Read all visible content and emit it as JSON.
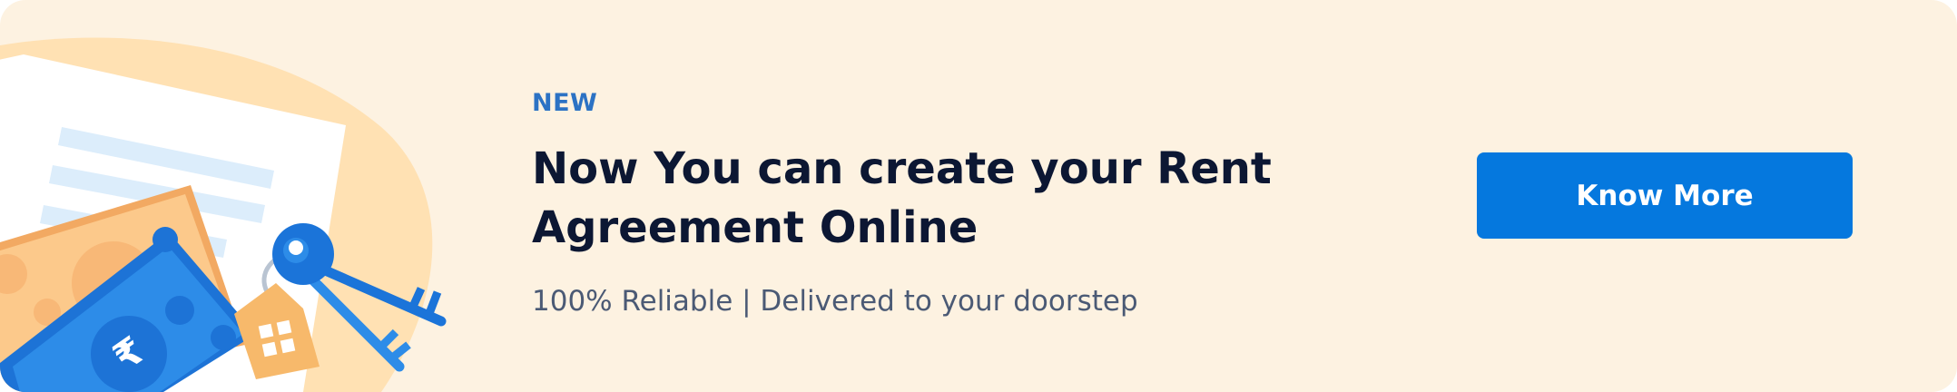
{
  "banner": {
    "tag": "NEW",
    "title": "Now You can create your Rent Agreement Online",
    "subtitle": "100% Reliable | Delivered to your doorstep",
    "cta_label": "Know More",
    "currency_symbol": "₹"
  },
  "colors": {
    "background": "#fdf2e1",
    "accent_blue": "#0578de",
    "tag_blue": "#2c72c4",
    "title": "#0c1733",
    "subtitle": "#4b5a75",
    "illustration_peach": "#ffe1b3",
    "illustration_orange": "#f7b96b"
  },
  "icons": [
    "document-icon",
    "banknote-icon",
    "house-keychain-icon",
    "key-icon"
  ]
}
